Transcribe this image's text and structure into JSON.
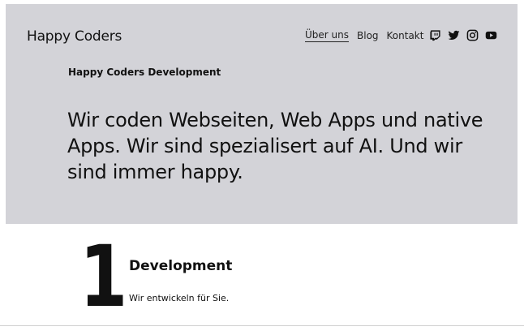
{
  "header": {
    "site_title": "Happy Coders",
    "nav": [
      {
        "label": "Über uns",
        "current": true
      },
      {
        "label": "Blog",
        "current": false
      },
      {
        "label": "Kontakt",
        "current": false
      }
    ],
    "social_icons": [
      "twitch-icon",
      "twitter-icon",
      "instagram-icon",
      "youtube-icon"
    ]
  },
  "hero": {
    "tagline": "Happy Coders Development",
    "headline": "Wir coden Webseiten, Web Apps und native Apps. Wir sind spezialisert auf AI. Und wir sind immer happy.",
    "background": "#d3d3d8"
  },
  "feature": {
    "number": "1",
    "title": "Development",
    "text": "Wir entwickeln für Sie."
  }
}
